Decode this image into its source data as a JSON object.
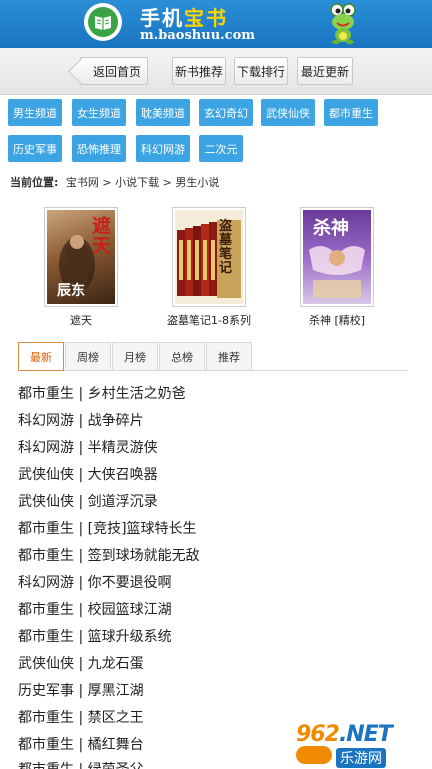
{
  "header": {
    "title_part1": "手机",
    "title_part2": "宝书",
    "url": "m.baoshuu.com"
  },
  "nav": {
    "back": "返回首页",
    "new_books": "新书推荐",
    "download_rank": "下载排行",
    "recent_update": "最近更新"
  },
  "categories": [
    "男生频道",
    "女生频道",
    "耽美频道",
    "玄幻奇幻",
    "武侠仙侠",
    "都市重生",
    "历史军事",
    "恐怖推理",
    "科幻网游",
    "二次元"
  ],
  "breadcrumb": {
    "label": "当前位置:",
    "path": "宝书网 > 小说下载 > 男生小说"
  },
  "books": [
    {
      "title": "遮天",
      "cover_text": "遮天",
      "author": "辰东"
    },
    {
      "title": "盗墓笔记1-8系列",
      "cover_text": "盗墓笔记"
    },
    {
      "title": "杀神 [精校]",
      "cover_text": "杀神"
    }
  ],
  "tabs": [
    "最新",
    "周榜",
    "月榜",
    "总榜",
    "推荐"
  ],
  "list": [
    "都市重生 | 乡村生活之奶爸",
    "科幻网游 | 战争碎片",
    "科幻网游 | 半精灵游侠",
    "武侠仙侠 | 大侠召唤器",
    "武侠仙侠 | 剑道浮沉录",
    "都市重生 | [竞技]篮球特长生",
    "都市重生 | 签到球场就能无敌",
    "科幻网游 | 你不要退役啊",
    "都市重生 | 校园篮球江湖",
    "都市重生 | 篮球升级系统",
    "武侠仙侠 | 九龙石蛋",
    "历史军事 | 厚黑江湖",
    "都市重生 | 禁区之王",
    "都市重生 | 橘红舞台",
    "都市重生 | 绿茵圣父"
  ],
  "watermark": {
    "brand": "962",
    "net": ".NET",
    "sub": "乐游网"
  }
}
